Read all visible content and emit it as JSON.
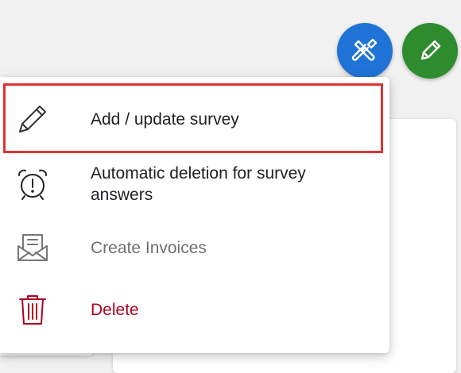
{
  "fabs": {
    "tools_icon": "tools-icon",
    "tools_color": "#1f73d6",
    "edit_icon": "pencil-icon",
    "edit_color": "#2e8b2e"
  },
  "menu": {
    "items": [
      {
        "label": "Add / update survey",
        "icon": "pencil-icon",
        "selected": true
      },
      {
        "label": "Automatic deletion for survey answers",
        "icon": "alarm-clock-icon"
      },
      {
        "label": "Create Invoices",
        "icon": "envelope-invoice-icon",
        "disabled": true
      },
      {
        "label": "Delete",
        "icon": "trash-icon",
        "color": "#b00020"
      }
    ]
  },
  "colors": {
    "highlight_border": "#e03131",
    "delete_red": "#b00020",
    "disabled_gray": "#707070"
  }
}
